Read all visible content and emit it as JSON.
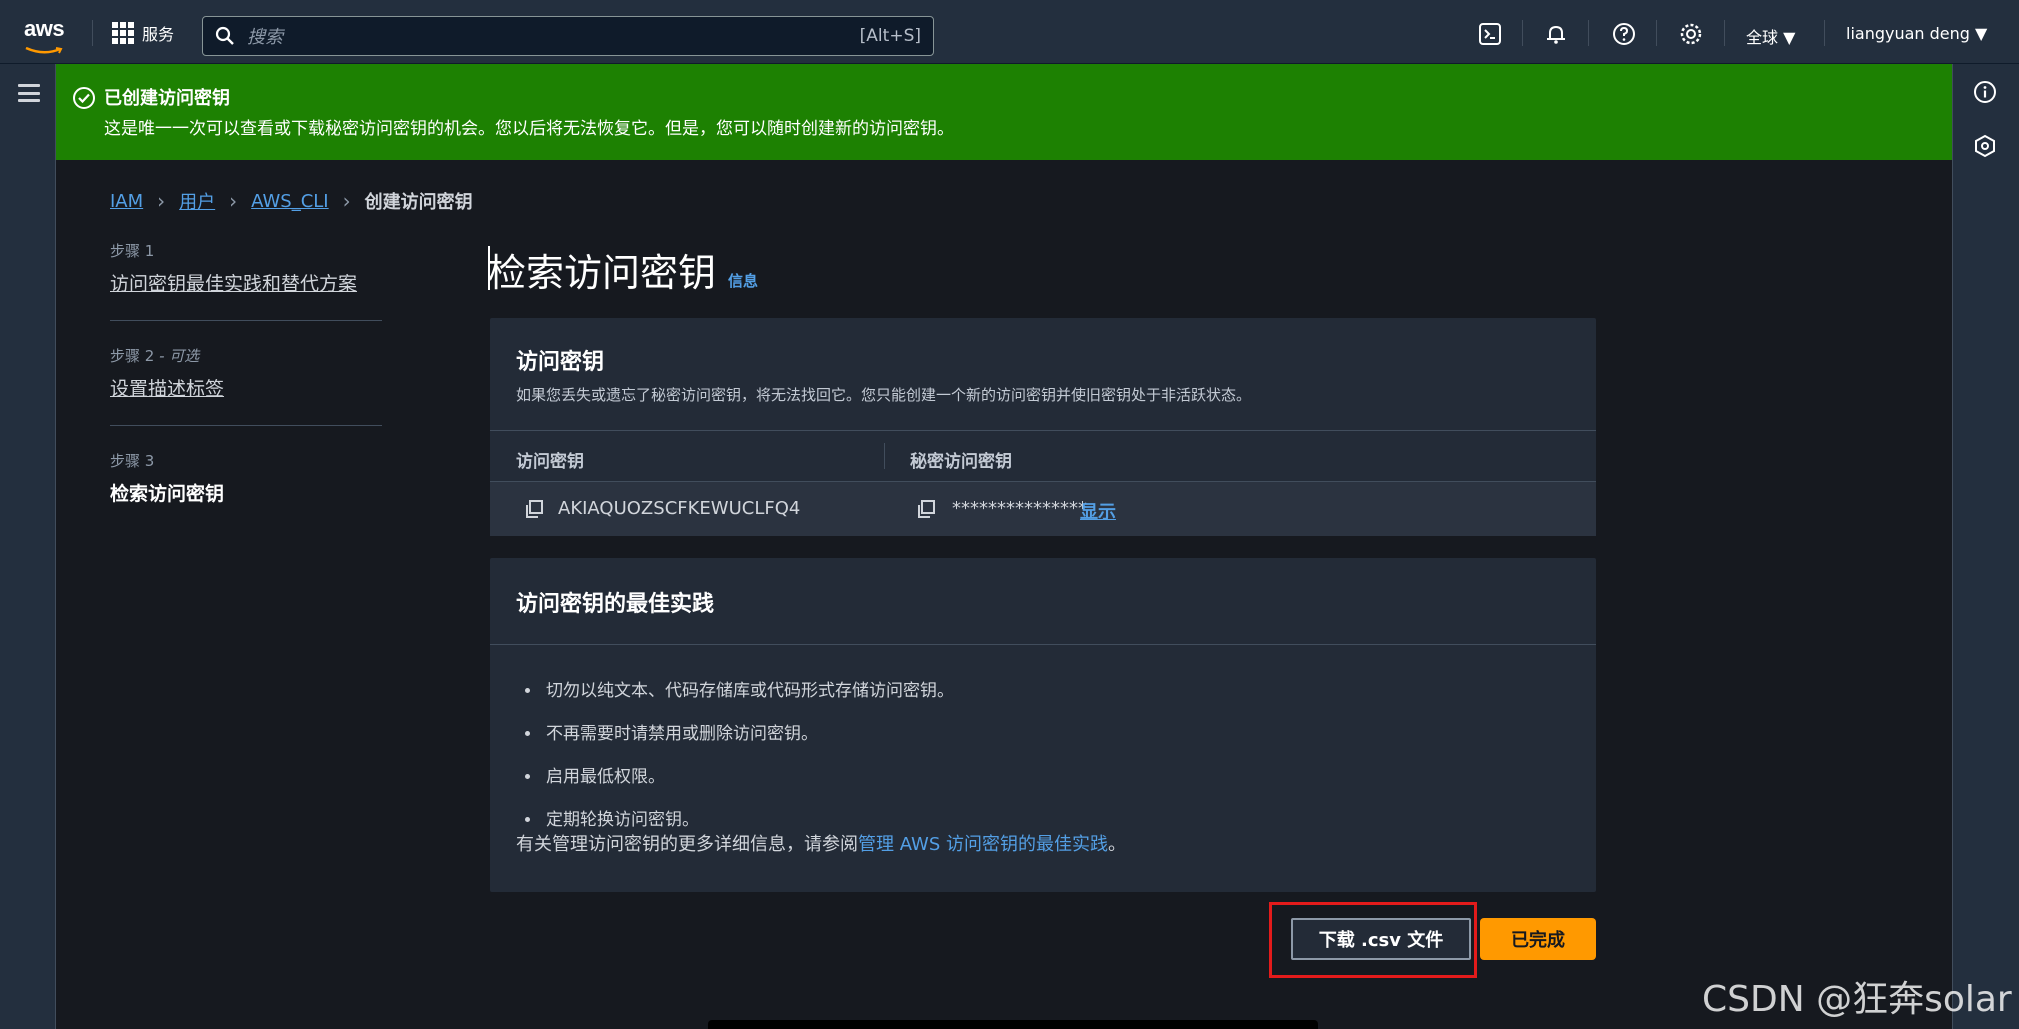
{
  "topnav": {
    "logo": "aws",
    "services": "服务",
    "search_placeholder": "搜索",
    "search_hint": "[Alt+S]",
    "region": "全球 ▼",
    "user": "liangyuan deng ▼"
  },
  "flash": {
    "title": "已创建访问密钥",
    "message": "这是唯一一次可以查看或下载秘密访问密钥的机会。您以后将无法恢复它。但是，您可以随时创建新的访问密钥。",
    "color": "#1d8102"
  },
  "breadcrumb": {
    "items": [
      "IAM",
      "用户",
      "AWS_CLI"
    ],
    "current": "创建访问密钥"
  },
  "steps": [
    {
      "num": "步骤 1",
      "label": "访问密钥最佳实践和替代方案"
    },
    {
      "num": "步骤 2",
      "optional": " - 可选",
      "label": "设置描述标签"
    },
    {
      "num": "步骤 3",
      "label": "检索访问密钥"
    }
  ],
  "page": {
    "title": "检索访问密钥",
    "info": "信息"
  },
  "access_key_card": {
    "title": "访问密钥",
    "description": "如果您丢失或遗忘了秘密访问密钥，将无法找回它。您只能创建一个新的访问密钥并使旧密钥处于非活跃状态。",
    "col_access_key": "访问密钥",
    "col_secret_key": "秘密访问密钥",
    "access_key_value": "AKIAQUOZSCFKEWUCLFQ4",
    "secret_key_masked": "***************",
    "show_label": "显示"
  },
  "best_practice_card": {
    "title": "访问密钥的最佳实践",
    "items": [
      "切勿以纯文本、代码存储库或代码形式存储访问密钥。",
      "不再需要时请禁用或删除访问密钥。",
      "启用最低权限。",
      "定期轮换访问密钥。"
    ],
    "more_prefix": "有关管理访问密钥的更多详细信息，请参阅",
    "more_link": "管理 AWS 访问密钥的最佳实践",
    "more_suffix": "。"
  },
  "actions": {
    "download": "下载 .csv 文件",
    "done": "已完成",
    "accent": "#ff9900"
  },
  "watermark": "CSDN @狂奔solar"
}
